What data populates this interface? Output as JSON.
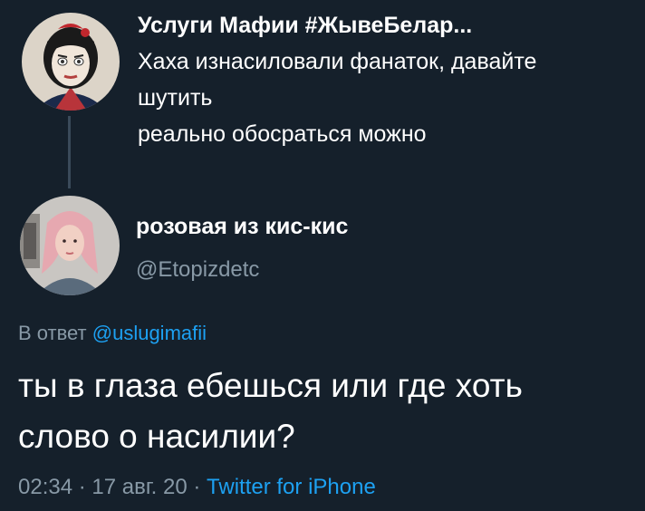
{
  "parent_tweet": {
    "author_name": "Услуги Мафии #ЖывеБелар...",
    "text_lines": [
      "Хаха изнасиловали фанаток, давайте",
      "шутить",
      "реально обосраться можно"
    ]
  },
  "tweet": {
    "author_name": "розовая из кис-кис",
    "handle": "@Etopizdetc",
    "replying_prefix": "В ответ ",
    "replying_to": "@uslugimafii",
    "text_lines": [
      "ты в глаза ебешься или где хоть",
      "слово о насилии?"
    ],
    "time": "02:34",
    "separator": " · ",
    "date": "17 авг. 20",
    "source": "Twitter for iPhone"
  },
  "colors": {
    "background": "#15202b",
    "primary_text": "#ffffff",
    "secondary_text": "#8899a6",
    "link": "#1da1f2",
    "thread_line": "#3a4a5a"
  },
  "icons": {
    "avatar_1": "cartoon-avatar-icon",
    "avatar_2": "user-photo-avatar-icon"
  }
}
